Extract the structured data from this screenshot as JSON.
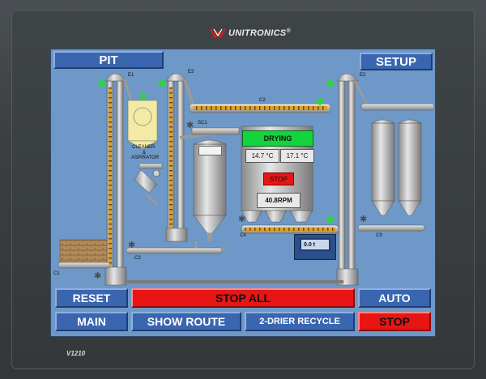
{
  "brand": {
    "name": "UNITRONICS",
    "mark": "®"
  },
  "model": "V1210",
  "buttons": {
    "pit": "PIT",
    "setup": "SETUP",
    "reset": "RESET",
    "stop_all": "STOP ALL",
    "auto": "AUTO",
    "main": "MAIN",
    "show_route": "SHOW ROUTE",
    "drier_recycle": "2-DRIER RECYCLE",
    "stop": "STOP"
  },
  "equipment_labels": {
    "e1": "E1",
    "e2": "E2",
    "e3": "E3",
    "c1": "C1",
    "c2": "C2",
    "c3": "C3",
    "c4": "C4",
    "c9": "C9",
    "sc1": "SC1",
    "cleaner_line1": "CLEANER",
    "cleaner_amp": "&",
    "cleaner_line2": "ASPIRATOR"
  },
  "drier": {
    "status": "DRYING",
    "temp1": "14.7 °C",
    "temp2": "17.1 °C",
    "stop_label": "STOP",
    "rpm": "40.8RPM"
  },
  "scale": {
    "weight": "0.0 t"
  },
  "colors": {
    "screen_bg": "#6d98c7",
    "button_blue": "#3a66b0",
    "button_red": "#e81515",
    "status_green": "#13d43c",
    "conveyor_orange": "#e0a020",
    "run_indicator": "#2bd63a"
  },
  "icons": [
    "unitronics-logo-icon",
    "run-asterisk-icon",
    "gear-icon"
  ]
}
